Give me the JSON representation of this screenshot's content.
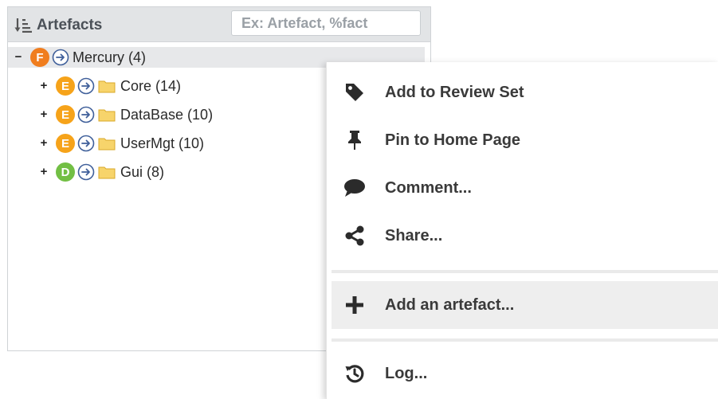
{
  "panel": {
    "title": "Artefacts",
    "search_placeholder": "Ex: Artefact, %fact"
  },
  "tree": {
    "root": {
      "expander": "−",
      "badge": "F",
      "badge_color": "#f07d1e",
      "label": "Mercury (4)"
    },
    "children": [
      {
        "expander": "+",
        "badge": "E",
        "badge_color": "#f6a31a",
        "label": "Core (14)"
      },
      {
        "expander": "+",
        "badge": "E",
        "badge_color": "#f6a31a",
        "label": "DataBase (10)"
      },
      {
        "expander": "+",
        "badge": "E",
        "badge_color": "#f6a31a",
        "label": "UserMgt (10)"
      },
      {
        "expander": "+",
        "badge": "D",
        "badge_color": "#72bf44",
        "label": "Gui (8)"
      }
    ]
  },
  "context_menu": {
    "items": [
      {
        "label": "Add to Review Set",
        "icon": "tag-icon"
      },
      {
        "label": "Pin to Home Page",
        "icon": "pin-icon"
      },
      {
        "label": "Comment...",
        "icon": "comment-icon"
      },
      {
        "label": "Share...",
        "icon": "share-icon"
      },
      {
        "label": "Add an artefact...",
        "icon": "plus-icon",
        "highlighted": true
      },
      {
        "label": "Log...",
        "icon": "history-icon"
      }
    ]
  }
}
